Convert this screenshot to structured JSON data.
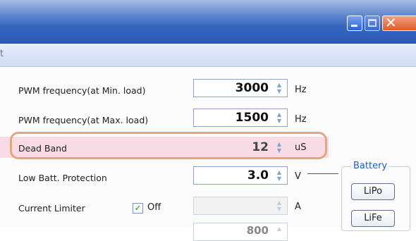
{
  "window": {
    "menu_fragment": "t",
    "controls": {
      "minimize_icon": "minimize-icon",
      "maximize_icon": "maximize-icon",
      "close_icon": "close-icon"
    }
  },
  "rows": [
    {
      "label": "PWM frequency(at Min. load)",
      "value": "3000",
      "unit": "Hz"
    },
    {
      "label": "PWM frequency(at Max. load)",
      "value": "1500",
      "unit": "Hz"
    },
    {
      "label": "Dead Band",
      "value": "12",
      "unit": "uS",
      "highlighted": true
    },
    {
      "label": "Low Batt. Protection",
      "value": "3.0",
      "unit": "V"
    },
    {
      "label": "Current Limiter",
      "value": "",
      "unit": "A",
      "disabled": true
    },
    {
      "label": "",
      "value": "800",
      "unit": ""
    }
  ],
  "current_limiter": {
    "checkbox_label": "Off",
    "checked": true
  },
  "battery": {
    "title": "Battery",
    "buttons": [
      "LiPo",
      "LiFe"
    ]
  },
  "colors": {
    "highlight_outline": "#e4a77d",
    "highlight_fill": "#f8dbe4",
    "titlebar": "#2a5ab6",
    "group_title": "#1d5fc0"
  }
}
